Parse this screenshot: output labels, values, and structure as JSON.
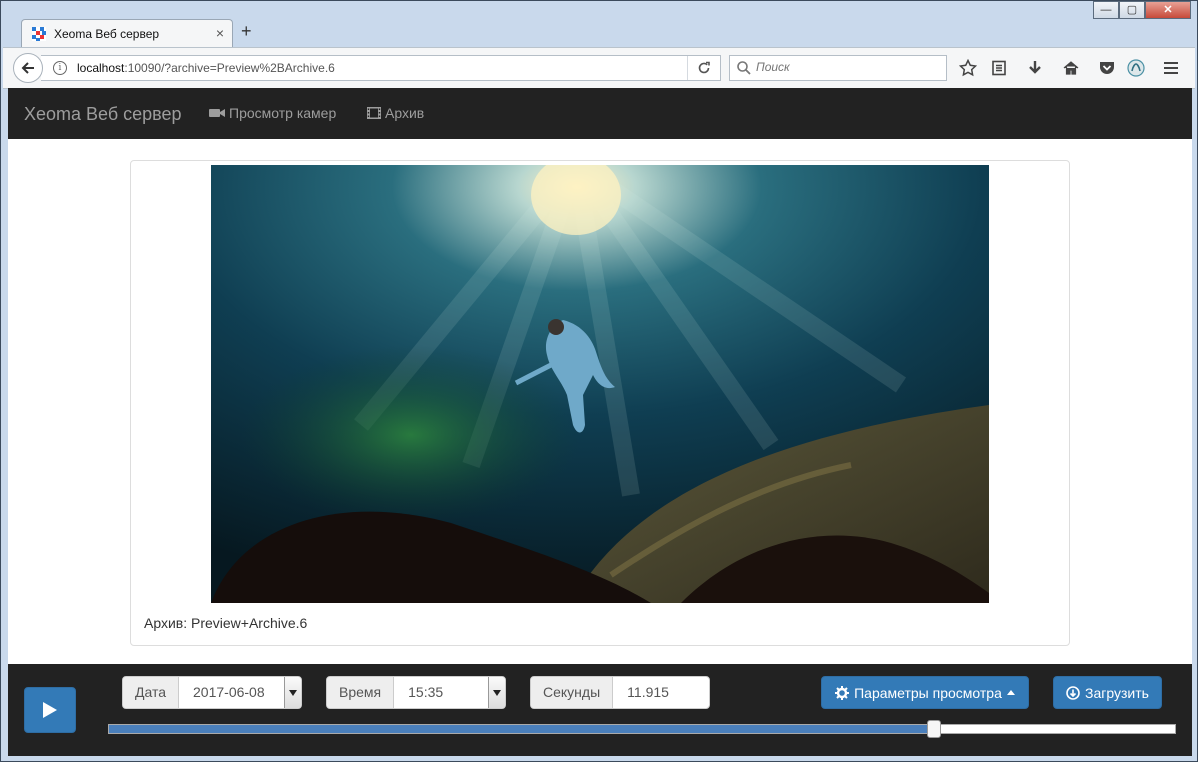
{
  "browser": {
    "tab_title": "Xeoma Веб сервер",
    "tab_close": "×",
    "new_tab": "+",
    "url_host": "localhost",
    "url_rest": ":10090/?archive=Preview%2BArchive.6",
    "search_placeholder": "Поиск",
    "info_glyph": "i"
  },
  "window_controls": {
    "minimize": "—",
    "maximize": "▢",
    "close": "✕"
  },
  "app": {
    "brand": "Xeoma Веб сервер",
    "nav": [
      {
        "label": "Просмотр камер"
      },
      {
        "label": "Архив"
      }
    ]
  },
  "viewer": {
    "caption": "Архив: Preview+Archive.6"
  },
  "controls": {
    "date_label": "Дата",
    "date_value": "2017-06-08",
    "time_label": "Время",
    "time_value": "15:35",
    "seconds_label": "Секунды",
    "seconds_value": "11.915",
    "view_params_label": "Параметры просмотра",
    "download_label": "Загрузить",
    "timeline_position": 0.774
  },
  "colors": {
    "primary": "#337ab7",
    "navbar": "#222222"
  }
}
